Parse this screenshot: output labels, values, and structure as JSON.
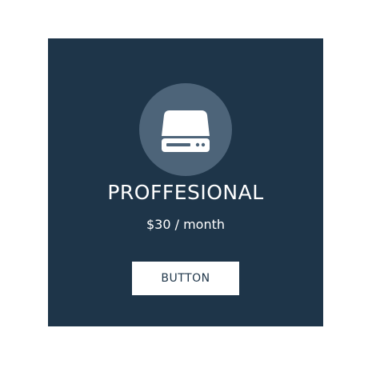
{
  "card": {
    "icon": "hard-drive-icon",
    "title": "PROFFESIONAL",
    "price": "$30 / month",
    "button_label": "BUTTON"
  },
  "colors": {
    "card_background": "#1e3549",
    "icon_circle": "#4d6479",
    "button_background": "#ffffff",
    "button_text": "#1e3549"
  }
}
